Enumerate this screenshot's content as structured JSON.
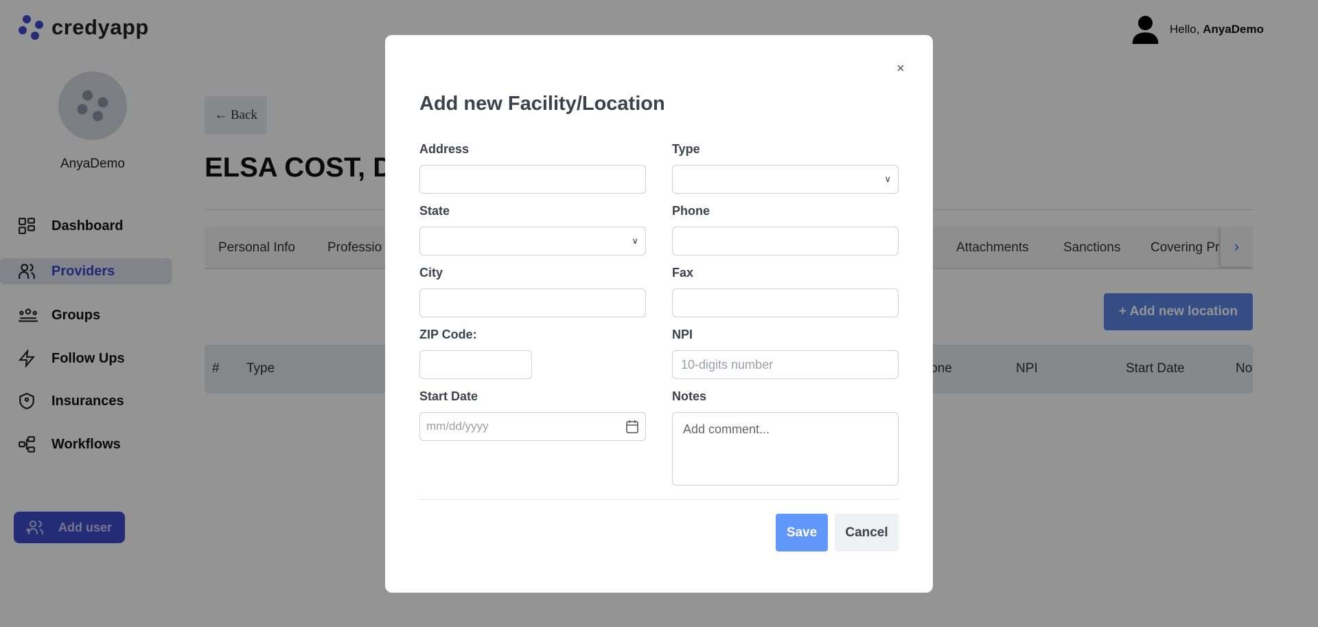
{
  "brand": {
    "name": "credyapp",
    "color": "#3f4ccf"
  },
  "user": {
    "name": "AnyaDemo",
    "greeting": "Hello,",
    "greeting_name": "AnyaDemo"
  },
  "sidebar": {
    "items": [
      {
        "label": "Dashboard",
        "icon": "grid-icon"
      },
      {
        "label": "Providers",
        "icon": "users-icon",
        "active": true
      },
      {
        "label": "Groups",
        "icon": "group-icon"
      },
      {
        "label": "Follow Ups",
        "icon": "bolt-icon"
      },
      {
        "label": "Insurances",
        "icon": "shield-icon"
      },
      {
        "label": "Workflows",
        "icon": "workflow-icon"
      }
    ],
    "add_user": "Add user"
  },
  "main": {
    "back": "Back",
    "title": "ELSA COST, DO",
    "tabs": [
      "Personal Info",
      "Professio",
      "Attachments",
      "Sanctions",
      "Covering Pr"
    ],
    "add_location": "+ Add new location",
    "columns": [
      "#",
      "Type",
      "Phone",
      "NPI",
      "Start Date",
      "Notes"
    ]
  },
  "modal": {
    "title": "Add new Facility/Location",
    "close": "×",
    "fields": {
      "address": {
        "label": "Address",
        "value": ""
      },
      "type": {
        "label": "Type",
        "value": ""
      },
      "state": {
        "label": "State",
        "value": ""
      },
      "phone": {
        "label": "Phone",
        "value": ""
      },
      "city": {
        "label": "City",
        "value": ""
      },
      "fax": {
        "label": "Fax",
        "value": ""
      },
      "zip": {
        "label": "ZIP Code:",
        "value": ""
      },
      "npi": {
        "label": "NPI",
        "placeholder": "10-digits number"
      },
      "start_date": {
        "label": "Start Date",
        "placeholder": "mm/dd/yyyy"
      },
      "notes": {
        "label": "Notes",
        "placeholder": "Add comment..."
      }
    },
    "save": "Save",
    "cancel": "Cancel"
  }
}
